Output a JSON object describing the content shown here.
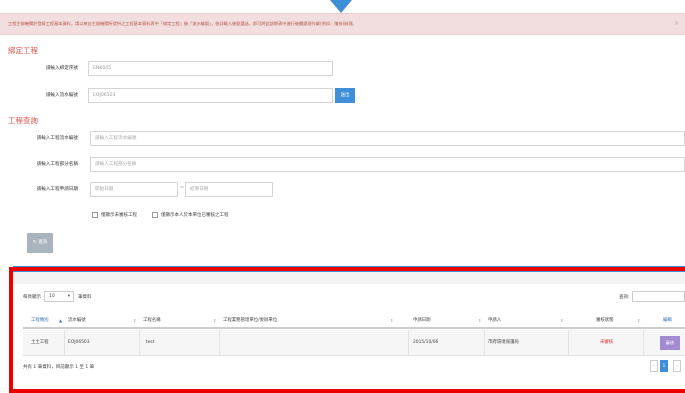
{
  "alert": {
    "text": "工程主辦機關於登錄工程基本資料，請以來自主辦機關所提供之工程基本資料表中「綁定工程」後「流水編號」，依詳輸入後點選送，即可將此該期表中進行後續處理作業(例如：稽核)辦理。",
    "close": "×"
  },
  "bind_section": {
    "title": "綁定工程",
    "label_cert": "請輸入綁定序號",
    "value_cert": "ENK045",
    "label_serial": "請輸入流水編號",
    "value_serial": "EOJ06503",
    "submit": "送出"
  },
  "query_section": {
    "title": "工程查詢",
    "label_serial": "請輸入工程流水編號",
    "placeholder_serial": "請輸入工程流水編號",
    "label_name": "請輸入工程部分名稱",
    "placeholder_name": "請輸入工程部分名稱",
    "label_date": "請輸入工程申請日期",
    "placeholder_start": "開始日期",
    "tilde": "~",
    "placeholder_end": "結束日期",
    "check1": "僅顯示未審核工程",
    "check2": "僅顯示本人於本單位已審核之工程",
    "search_button": "查詢"
  },
  "table": {
    "length_prefix": "每頁顯示",
    "length_value": "10",
    "length_suffix": "筆資料",
    "search_label": "查詢:",
    "columns": [
      "工程類別",
      "流水編號",
      "工程名稱",
      "工程業務管理單位/委辦單位",
      "申請日期",
      "申請人",
      "審核狀態",
      "編輯"
    ],
    "rows": [
      {
        "category": "土土工程",
        "serial": "EOJ06503",
        "name": "test",
        "unit": "",
        "date": "2015/10/06",
        "applicant": "市府環境保護局",
        "status": "未審核",
        "action": "審核"
      }
    ],
    "info": "共有 1 筆資料，目前顯示 1 至 1 筆",
    "pager": [
      "‹",
      "1",
      "›"
    ]
  },
  "colors": {
    "accent_blue": "#3e8fd8",
    "highlight_red": "#ee0000",
    "status_red": "#ee3333",
    "section_red": "#d9534f"
  }
}
